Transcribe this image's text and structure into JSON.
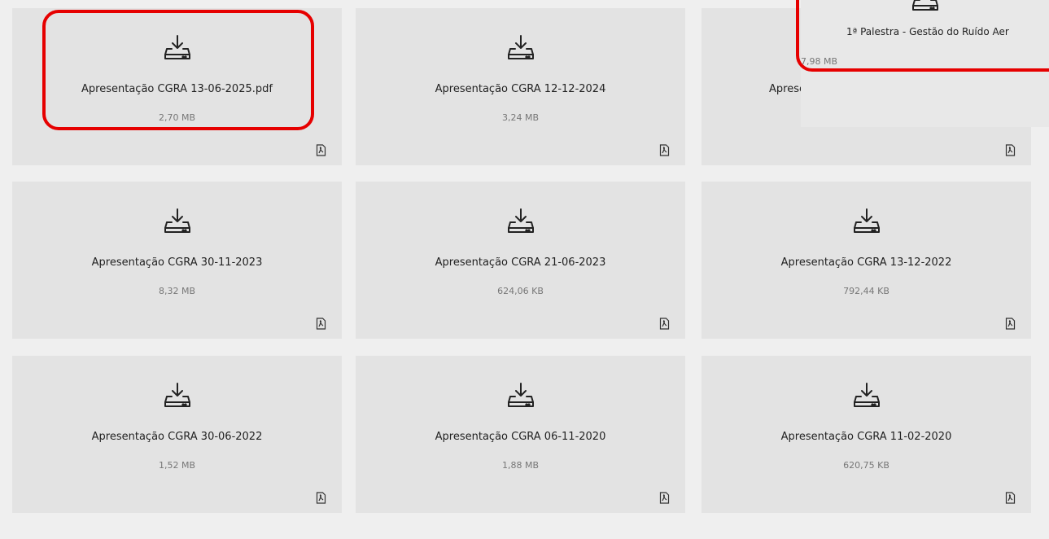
{
  "files": [
    {
      "name": "Apresentação CGRA 13-06-2025.pdf",
      "size": "2,70 MB"
    },
    {
      "name": "Apresentação CGRA 12-12-2024",
      "size": "3,24 MB"
    },
    {
      "name": "Apresentação CGRA 13-12-2023",
      "size": ""
    },
    {
      "name": "Apresentação CGRA 30-11-2023",
      "size": "8,32 MB"
    },
    {
      "name": "Apresentação CGRA 21-06-2023",
      "size": "624,06 KB"
    },
    {
      "name": "Apresentação CGRA 13-12-2022",
      "size": "792,44 KB"
    },
    {
      "name": "Apresentação CGRA 30-06-2022",
      "size": "1,52 MB"
    },
    {
      "name": "Apresentação CGRA 06-11-2020",
      "size": "1,88 MB"
    },
    {
      "name": "Apresentação CGRA 11-02-2020",
      "size": "620,75 KB"
    }
  ],
  "popup": {
    "name": "1ª Palestra - Gestão do Ruído Aer",
    "size": "7,98 MB"
  },
  "colors": {
    "highlight": "#e60000",
    "card_bg": "#e3e3e3",
    "page_bg": "#efefef"
  },
  "icons": {
    "download": "download-tray-icon",
    "file": "pdf-file-icon"
  }
}
